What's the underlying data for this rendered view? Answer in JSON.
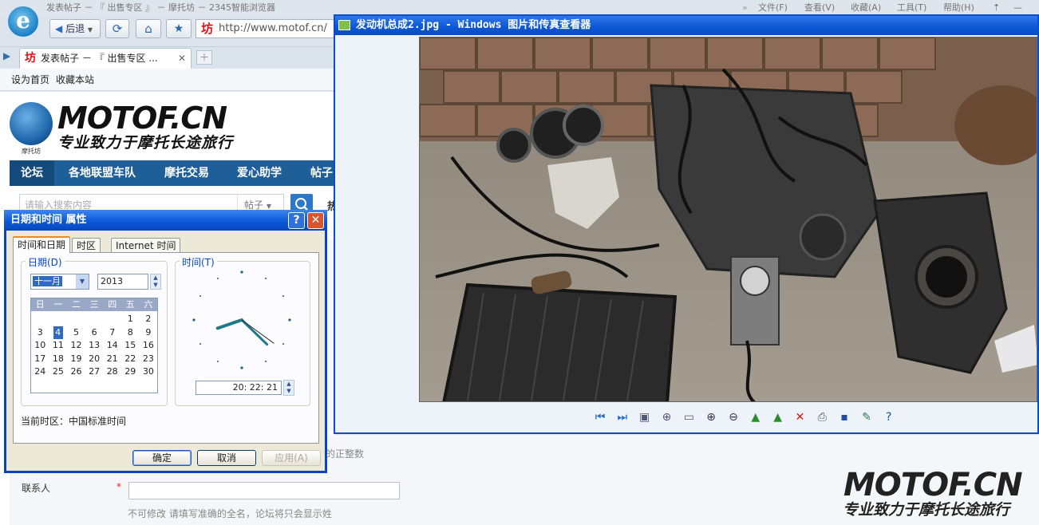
{
  "browser": {
    "title": "发表帖子 － 『 出售专区 』 － 摩托坊 － 2345智能浏览器",
    "logo_letter": "e",
    "back_label": "后退",
    "address": "http://www.motof.cn/",
    "menu": [
      "文件(F)",
      "查看(V)",
      "收藏(A)",
      "工具(T)",
      "帮助(H)"
    ],
    "tab_title": "发表帖子 － 『 出售专区 ...",
    "favbar": [
      "设为首页",
      "收藏本站"
    ]
  },
  "site": {
    "logo": "MOTOF.CN",
    "logo_badge": "摩托坊",
    "slogan": "专业致力于摩托长途旅行",
    "nav": [
      "论坛",
      "各地联盟车队",
      "摩托交易",
      "爱心助学",
      "帖子"
    ],
    "search_placeholder": "请输入搜索内容",
    "search_scope": "帖子",
    "search_extra": "热",
    "form": {
      "price_hint": "的正整数",
      "contact_label": "联系人",
      "required_mark": "*",
      "contact_hint": "不可修改  请填写准确的全名，论坛将只会显示姓"
    }
  },
  "viewer": {
    "title": "发动机总成2.jpg - Windows 图片和传真查看器",
    "tools": [
      "prev-icon",
      "next-icon",
      "best-fit-icon",
      "actual-size-icon",
      "slideshow-icon",
      "zoom-in-icon",
      "zoom-out-icon",
      "rotate-cw-icon",
      "rotate-ccw-icon",
      "delete-icon",
      "print-icon",
      "save-icon",
      "edit-icon",
      "help-icon"
    ]
  },
  "dialog": {
    "title": "日期和时间 属性",
    "tabs": [
      "时间和日期",
      "时区",
      "Internet 时间"
    ],
    "date_group": "日期(D)",
    "time_group": "时间(T)",
    "month": "十一月",
    "year": "2013",
    "weekdays": [
      "日",
      "一",
      "二",
      "三",
      "四",
      "五",
      "六"
    ],
    "weeks": [
      [
        "",
        "",
        "",
        "",
        "",
        "1",
        "2"
      ],
      [
        "3",
        "4",
        "5",
        "6",
        "7",
        "8",
        "9"
      ],
      [
        "10",
        "11",
        "12",
        "13",
        "14",
        "15",
        "16"
      ],
      [
        "17",
        "18",
        "19",
        "20",
        "21",
        "22",
        "23"
      ],
      [
        "24",
        "25",
        "26",
        "27",
        "28",
        "29",
        "30"
      ]
    ],
    "selected_day": "4",
    "time": "20: 22: 21",
    "timezone_label": "当前时区：",
    "timezone": "中国标准时间",
    "ok": "确定",
    "cancel": "取消",
    "apply": "应用(A)"
  },
  "watermark": {
    "logo": "MOTOF.CN",
    "slogan": "专业致力于摩托长途旅行"
  },
  "colors": {
    "xp_blue": "#0b58d8",
    "site_nav": "#1f5f99",
    "selected_day": "#316ac5"
  }
}
